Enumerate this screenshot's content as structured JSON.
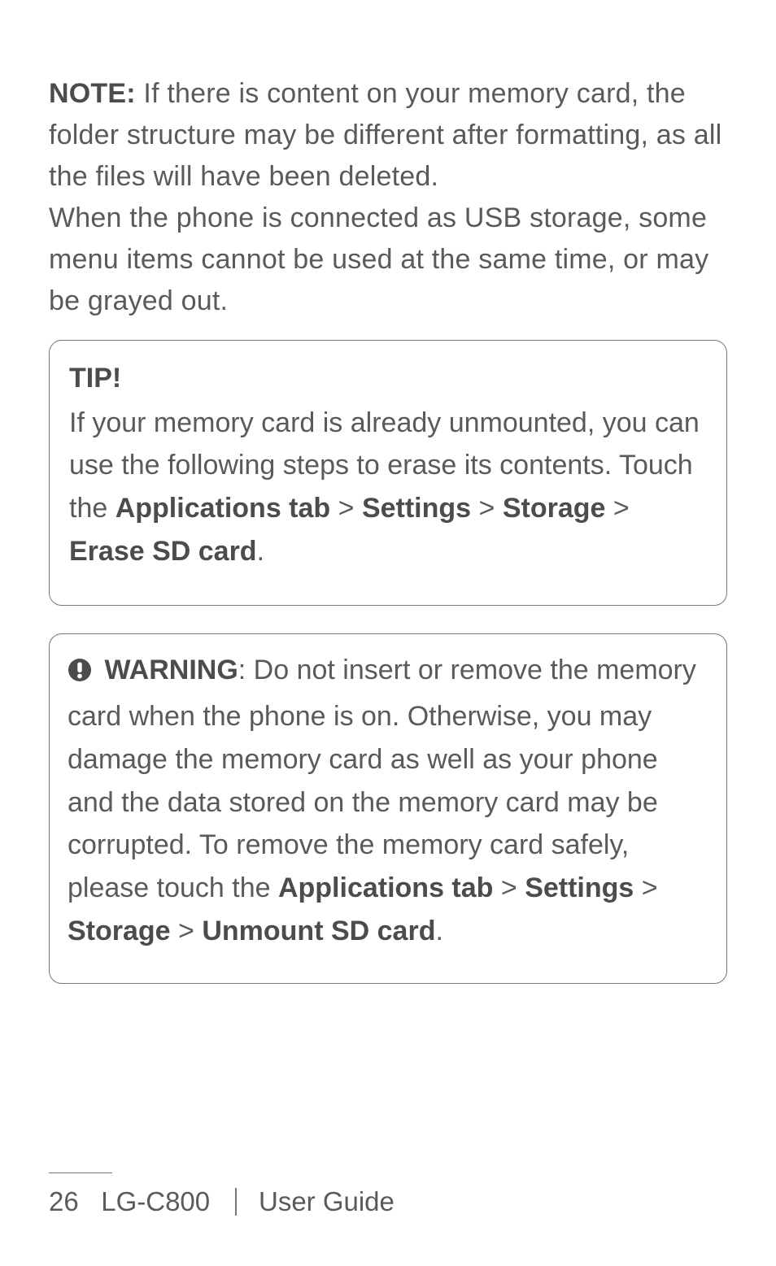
{
  "paragraph1": {
    "note_label": "NOTE:",
    "note_text": " If there is content on your memory card, the folder structure may be different after formatting, as all the files will have been deleted.",
    "line2": "When the phone is connected as USB storage, some menu items cannot be used at the same time, or may be grayed out."
  },
  "tip": {
    "title": "TIP!",
    "seg1": "If your memory card is already unmounted, you can use the following steps to erase its contents. Touch the ",
    "b1": "Applications tab",
    "gt1": " > ",
    "b2": "Settings",
    "gt2": " > ",
    "b3": "Storage",
    "gt3": " > ",
    "b4": "Erase SD card",
    "period": "."
  },
  "warning": {
    "label": " WARNING",
    "seg1": ": Do not insert or remove the memory card when the phone is on. Otherwise, you may damage the memory card as well as your phone and the data stored on the memory card may be corrupted. To remove the memory card safely, please touch the ",
    "b1": "Applications tab",
    "gt1": " > ",
    "b2": "Settings",
    "gt2": " > ",
    "b3": "Storage",
    "gt3": " > ",
    "b4": "Unmount SD card",
    "period": "."
  },
  "footer": {
    "page_number": "26",
    "model": "LG-C800",
    "guide": "User Guide"
  }
}
